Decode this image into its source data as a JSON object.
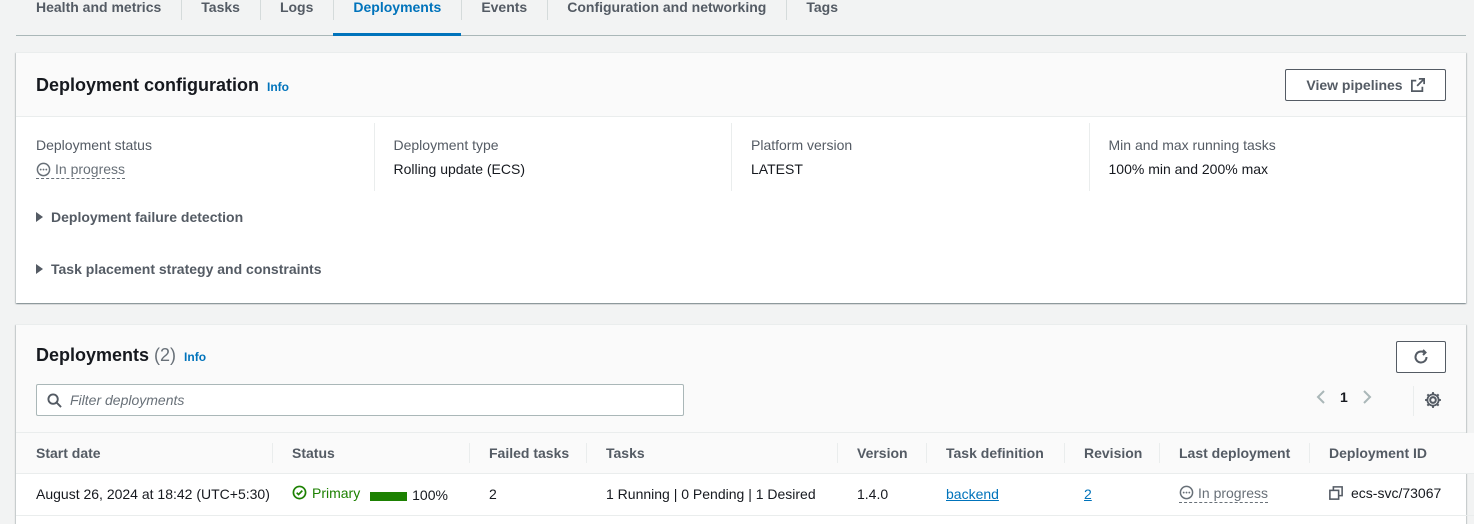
{
  "tabs": [
    {
      "label": "Health and metrics",
      "active": false
    },
    {
      "label": "Tasks",
      "active": false
    },
    {
      "label": "Logs",
      "active": false
    },
    {
      "label": "Deployments",
      "active": true
    },
    {
      "label": "Events",
      "active": false
    },
    {
      "label": "Configuration and networking",
      "active": false
    },
    {
      "label": "Tags",
      "active": false
    }
  ],
  "config": {
    "title": "Deployment configuration",
    "info": "Info",
    "view_pipelines": "View pipelines",
    "fields": [
      {
        "label": "Deployment status",
        "value": "In progress"
      },
      {
        "label": "Deployment type",
        "value": "Rolling update (ECS)"
      },
      {
        "label": "Platform version",
        "value": "LATEST"
      },
      {
        "label": "Min and max running tasks",
        "value": "100% min and 200% max"
      }
    ],
    "expanders": [
      "Deployment failure detection",
      "Task placement strategy and constraints"
    ]
  },
  "deployments": {
    "title": "Deployments",
    "count": "(2)",
    "info": "Info",
    "filter_placeholder": "Filter deployments",
    "page": "1",
    "columns": [
      "Start date",
      "Status",
      "Failed tasks",
      "Tasks",
      "Version",
      "Task definition",
      "Revision",
      "Last deployment",
      "Deployment ID"
    ],
    "rows": [
      {
        "start_date": "August 26, 2024 at 18:42 (UTC+5:30)",
        "status": "Primary",
        "progress_pct": 100,
        "progress_label": "100%",
        "failed_tasks": "2",
        "tasks": "1 Running | 0 Pending | 1 Desired",
        "version": "1.4.0",
        "task_definition": "backend",
        "revision": "2",
        "last_deployment": "In progress",
        "deployment_id": "ecs-svc/73067"
      }
    ]
  },
  "colors": {
    "accent": "#0073bb",
    "success": "#1d8102",
    "muted": "#545b64"
  }
}
